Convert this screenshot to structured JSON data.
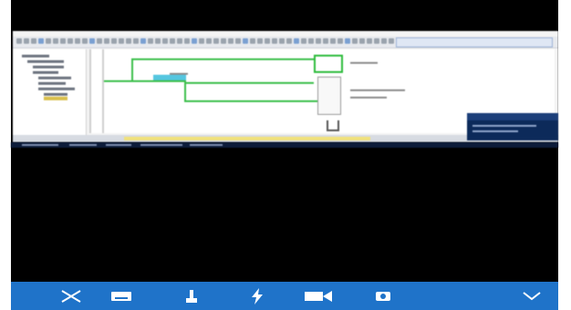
{
  "screen": {
    "background": "#000000",
    "captured_window": {
      "toolbar_icon_count": 52,
      "ladder_colors": {
        "wire": "#3cbf4a",
        "coil": "#2dbb3b"
      }
    }
  },
  "bottom_toolbar": {
    "background": "#1f73c9",
    "buttons": [
      {
        "name": "close-icon"
      },
      {
        "name": "keyboard-icon"
      },
      {
        "name": "pointer-icon"
      },
      {
        "name": "flash-icon"
      },
      {
        "name": "record-icon"
      },
      {
        "name": "settings-icon"
      },
      {
        "name": "chevron-down-icon"
      }
    ]
  }
}
